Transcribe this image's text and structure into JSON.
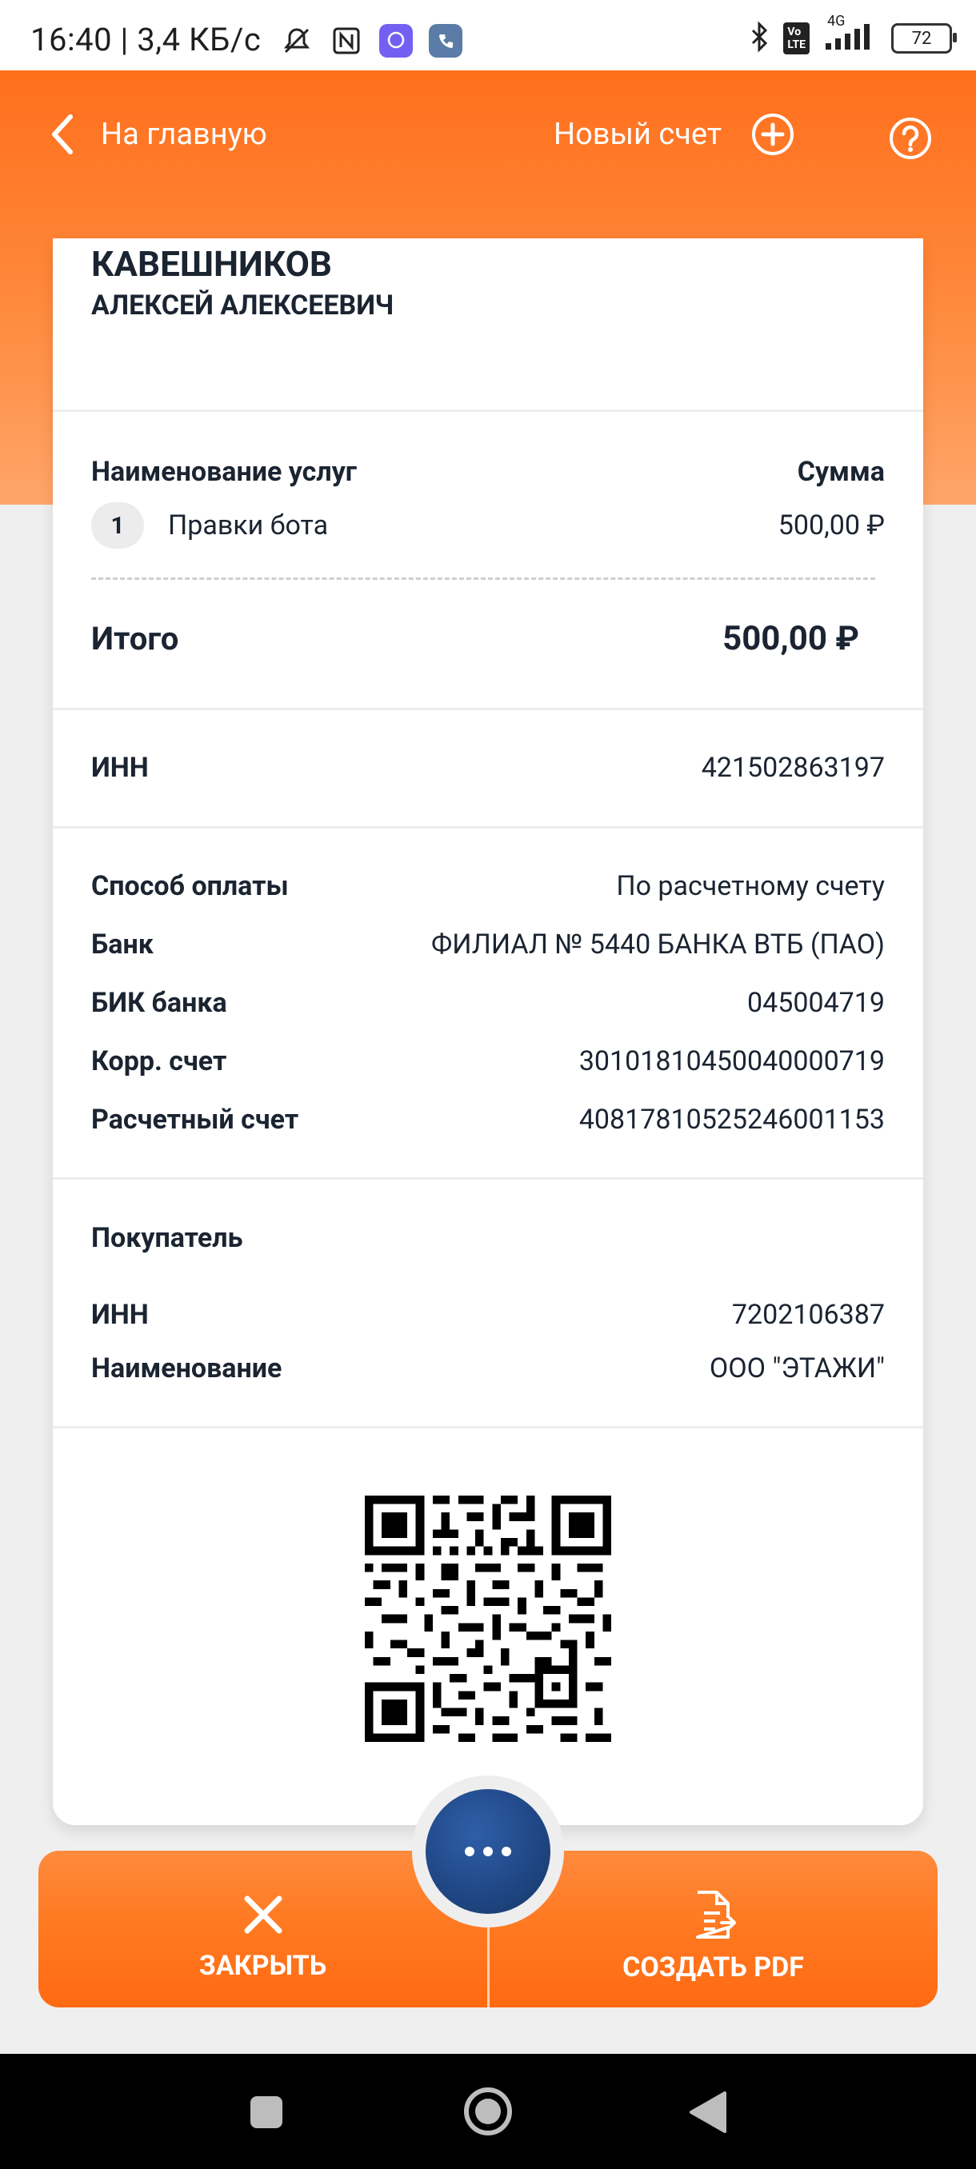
{
  "status_bar": {
    "time_speed": "16:40 | 3,4 КБ/с",
    "network": "4G",
    "battery": "72"
  },
  "nav": {
    "back_label": "На главную",
    "new_invoice_label": "Новый счет"
  },
  "seller": {
    "last_name": "КАВЕШНИКОВ",
    "first_names": "АЛЕКСЕЙ АЛЕКСЕЕВИЧ"
  },
  "services": {
    "header_name": "Наименование услуг",
    "header_sum": "Сумма",
    "items": [
      {
        "num": "1",
        "name": "Правки бота",
        "amount": "500,00 ₽"
      }
    ],
    "total_label": "Итого",
    "total_value": "500,00 ₽"
  },
  "seller_inn": {
    "label": "ИНН",
    "value": "421502863197"
  },
  "payment": {
    "method_label": "Способ оплаты",
    "method_value": "По расчетному счету",
    "bank_label": "Банк",
    "bank_value": "ФИЛИАЛ № 5440 БАНКА ВТБ (ПАО)",
    "bik_label": "БИК банка",
    "bik_value": "045004719",
    "corr_label": "Корр. счет",
    "corr_value": "30101810450040000719",
    "account_label": "Расчетный счет",
    "account_value": "40817810525246001153"
  },
  "buyer": {
    "title": "Покупатель",
    "inn_label": "ИНН",
    "inn_value": "7202106387",
    "name_label": "Наименование",
    "name_value": "ООО \"ЭТАЖИ\""
  },
  "actions": {
    "close_label": "ЗАКРЫТЬ",
    "pdf_label": "СОЗДАТЬ PDF"
  },
  "colors": {
    "brand_orange": "#ff7a22",
    "fab_blue": "#1f4683"
  }
}
